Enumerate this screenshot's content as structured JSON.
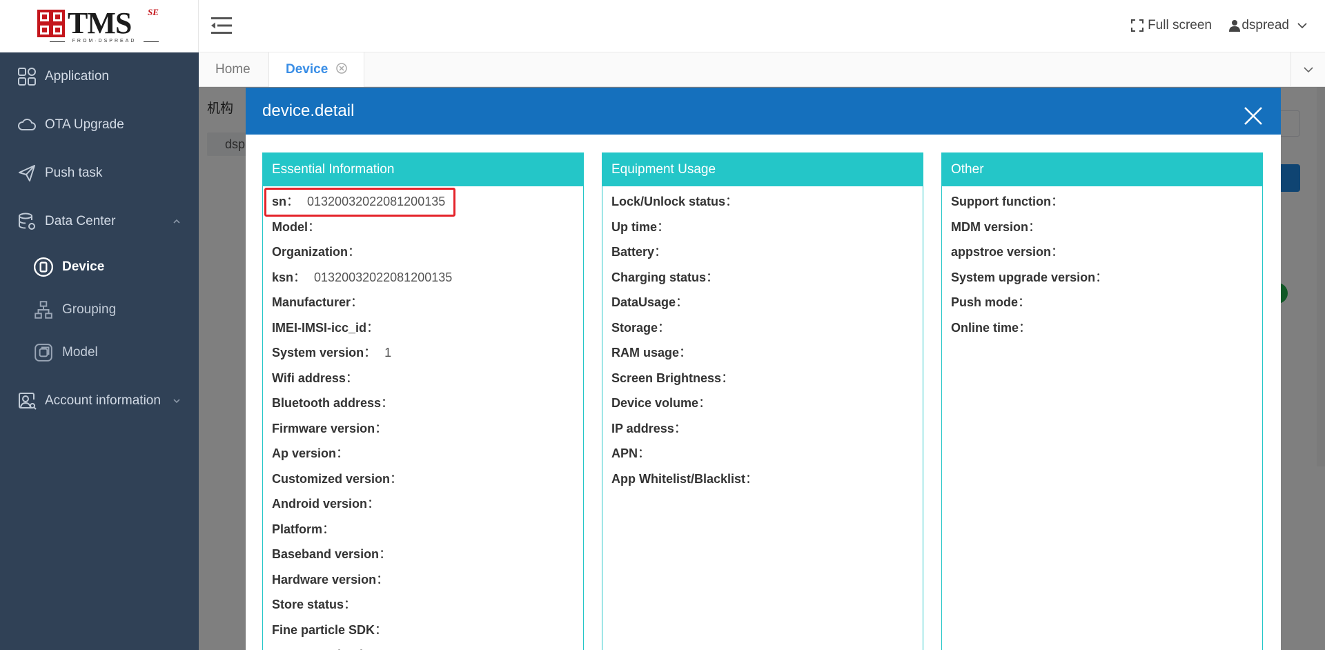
{
  "logo": {
    "text": "TMS",
    "badge": "SE",
    "tagline": "FROM·DSPREAD"
  },
  "sidebar": {
    "items": [
      {
        "label": "Application",
        "icon": "grid-apps-icon"
      },
      {
        "label": "OTA Upgrade",
        "icon": "cloud-icon"
      },
      {
        "label": "Push task",
        "icon": "paper-plane-icon"
      },
      {
        "label": "Data Center",
        "icon": "database-gear-icon",
        "expanded": true,
        "children": [
          {
            "label": "Device",
            "icon": "device-icon",
            "active": true
          },
          {
            "label": "Grouping",
            "icon": "hierarchy-icon"
          },
          {
            "label": "Model",
            "icon": "model-box-icon"
          }
        ]
      },
      {
        "label": "Account information",
        "icon": "account-icon",
        "expanded": false
      }
    ]
  },
  "navbar": {
    "fullscreen_label": "Full screen",
    "username": "dspread"
  },
  "tags": [
    {
      "label": "Home",
      "active": false
    },
    {
      "label": "Device",
      "active": true
    }
  ],
  "background": {
    "label": "机构",
    "chip": "dsp"
  },
  "dialog": {
    "title": "device.detail",
    "panels": [
      {
        "title": "Essential Information",
        "rows": [
          {
            "key": "sn",
            "value": "01320032022081200135",
            "highlighted": true
          },
          {
            "key": "Model",
            "value": ""
          },
          {
            "key": "Organization",
            "value": ""
          },
          {
            "key": "ksn",
            "value": "01320032022081200135"
          },
          {
            "key": "Manufacturer",
            "value": ""
          },
          {
            "key": "IMEI-IMSI-icc_id",
            "value": ""
          },
          {
            "key": "System version",
            "value": "1"
          },
          {
            "key": "Wifi address",
            "value": ""
          },
          {
            "key": "Bluetooth address",
            "value": ""
          },
          {
            "key": "Firmware version",
            "value": ""
          },
          {
            "key": "Ap version",
            "value": ""
          },
          {
            "key": "Customized version",
            "value": ""
          },
          {
            "key": "Android version",
            "value": ""
          },
          {
            "key": "Platform",
            "value": ""
          },
          {
            "key": "Baseband version",
            "value": ""
          },
          {
            "key": "Hardware version",
            "value": ""
          },
          {
            "key": "Store status",
            "value": ""
          },
          {
            "key": "Fine particle SDK",
            "value": ""
          },
          {
            "key": "Coarse-grained SDK",
            "value": ""
          }
        ]
      },
      {
        "title": "Equipment Usage",
        "rows": [
          {
            "key": "Lock/Unlock status",
            "value": ""
          },
          {
            "key": "Up time",
            "value": ""
          },
          {
            "key": "Battery",
            "value": ""
          },
          {
            "key": "Charging status",
            "value": ""
          },
          {
            "key": "DataUsage",
            "value": ""
          },
          {
            "key": "Storage",
            "value": ""
          },
          {
            "key": "RAM usage",
            "value": ""
          },
          {
            "key": "Screen Brightness",
            "value": ""
          },
          {
            "key": "Device volume",
            "value": ""
          },
          {
            "key": "IP address",
            "value": ""
          },
          {
            "key": "APN",
            "value": ""
          },
          {
            "key": "App Whitelist/Blacklist",
            "value": ""
          }
        ]
      },
      {
        "title": "Other",
        "rows": [
          {
            "key": "Support function",
            "value": ""
          },
          {
            "key": "MDM version",
            "value": ""
          },
          {
            "key": "appstroe version",
            "value": ""
          },
          {
            "key": "System upgrade version",
            "value": ""
          },
          {
            "key": "Push mode",
            "value": ""
          },
          {
            "key": "Online time",
            "value": ""
          }
        ]
      }
    ]
  },
  "colors": {
    "sidebar_bg": "#304156",
    "dialog_header": "#1570bd",
    "panel_accent": "#24c6c8",
    "highlight_border": "#e4232a",
    "active_tag": "#3a8ee6"
  }
}
